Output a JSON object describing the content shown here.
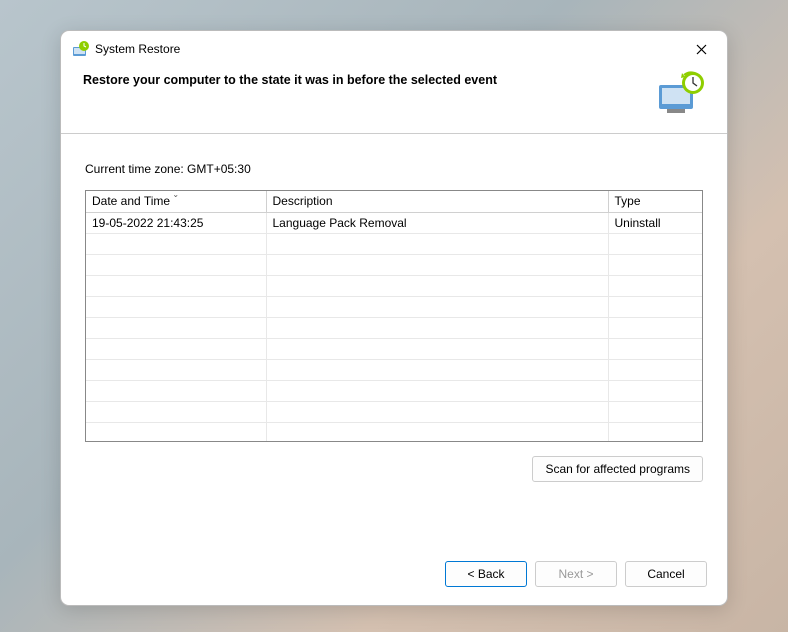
{
  "window": {
    "title": "System Restore"
  },
  "header": {
    "heading": "Restore your computer to the state it was in before the selected event"
  },
  "content": {
    "timezone_label": "Current time zone: GMT+05:30",
    "columns": {
      "date": "Date and Time",
      "description": "Description",
      "type": "Type"
    },
    "rows": [
      {
        "date": "19-05-2022 21:43:25",
        "description": "Language Pack Removal",
        "type": "Uninstall"
      }
    ],
    "scan_button": "Scan for affected programs"
  },
  "footer": {
    "back": "< Back",
    "next": "Next >",
    "cancel": "Cancel"
  }
}
